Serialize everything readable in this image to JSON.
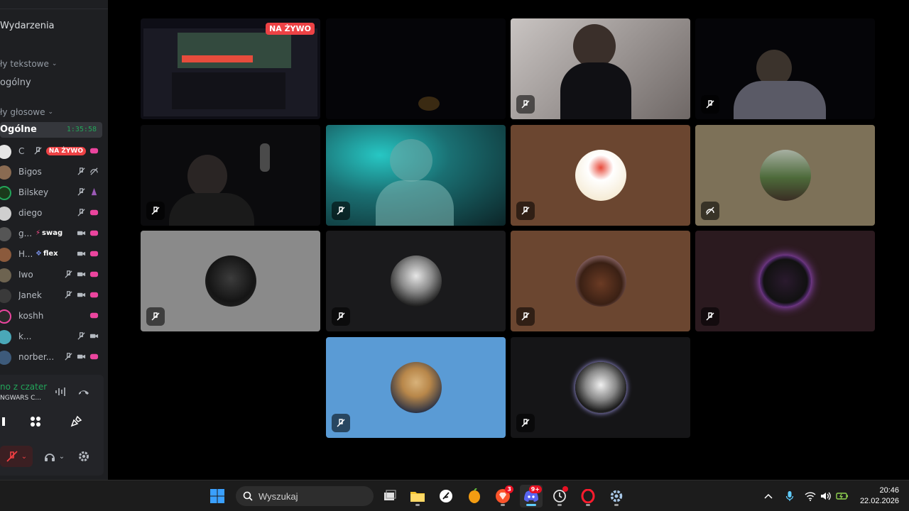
{
  "sidebar": {
    "events_label": "Wydarzenia",
    "text_category": "ły tekstowe",
    "text_channel": "ogólny",
    "voice_category": "ły głosowe",
    "voice_channel": "Ogólne",
    "voice_timer": "1:35:58",
    "live_tag": "NA ŻYWO",
    "members": [
      {
        "name": "C",
        "live": true
      },
      {
        "name": "Bigos"
      },
      {
        "name": "Bilskey"
      },
      {
        "name": "diego"
      },
      {
        "name": "g...",
        "badge": "swag"
      },
      {
        "name": "H...",
        "badge": "flex"
      },
      {
        "name": "Iwo"
      },
      {
        "name": "Janek"
      },
      {
        "name": "koshh"
      },
      {
        "name": "k..."
      },
      {
        "name": "norber..."
      }
    ]
  },
  "voice_panel": {
    "status": "no z czater",
    "subtitle": "NGWARS C..."
  },
  "stage": {
    "live_badge": "NA ŻYWO"
  },
  "taskbar": {
    "search_placeholder": "Wyszukaj",
    "brave_badge": "3",
    "discord_badge": "9+",
    "time": "20:46",
    "date": "22.02.2026"
  },
  "colors": {
    "live_red": "#ed4245",
    "connected_green": "#23a55a",
    "sidebar_bg": "#1e1f22",
    "tile_brown": "#6b4630",
    "tile_khaki": "#7d7158",
    "tile_gray": "#8a8a8a",
    "tile_blue": "#5a9bd5"
  }
}
